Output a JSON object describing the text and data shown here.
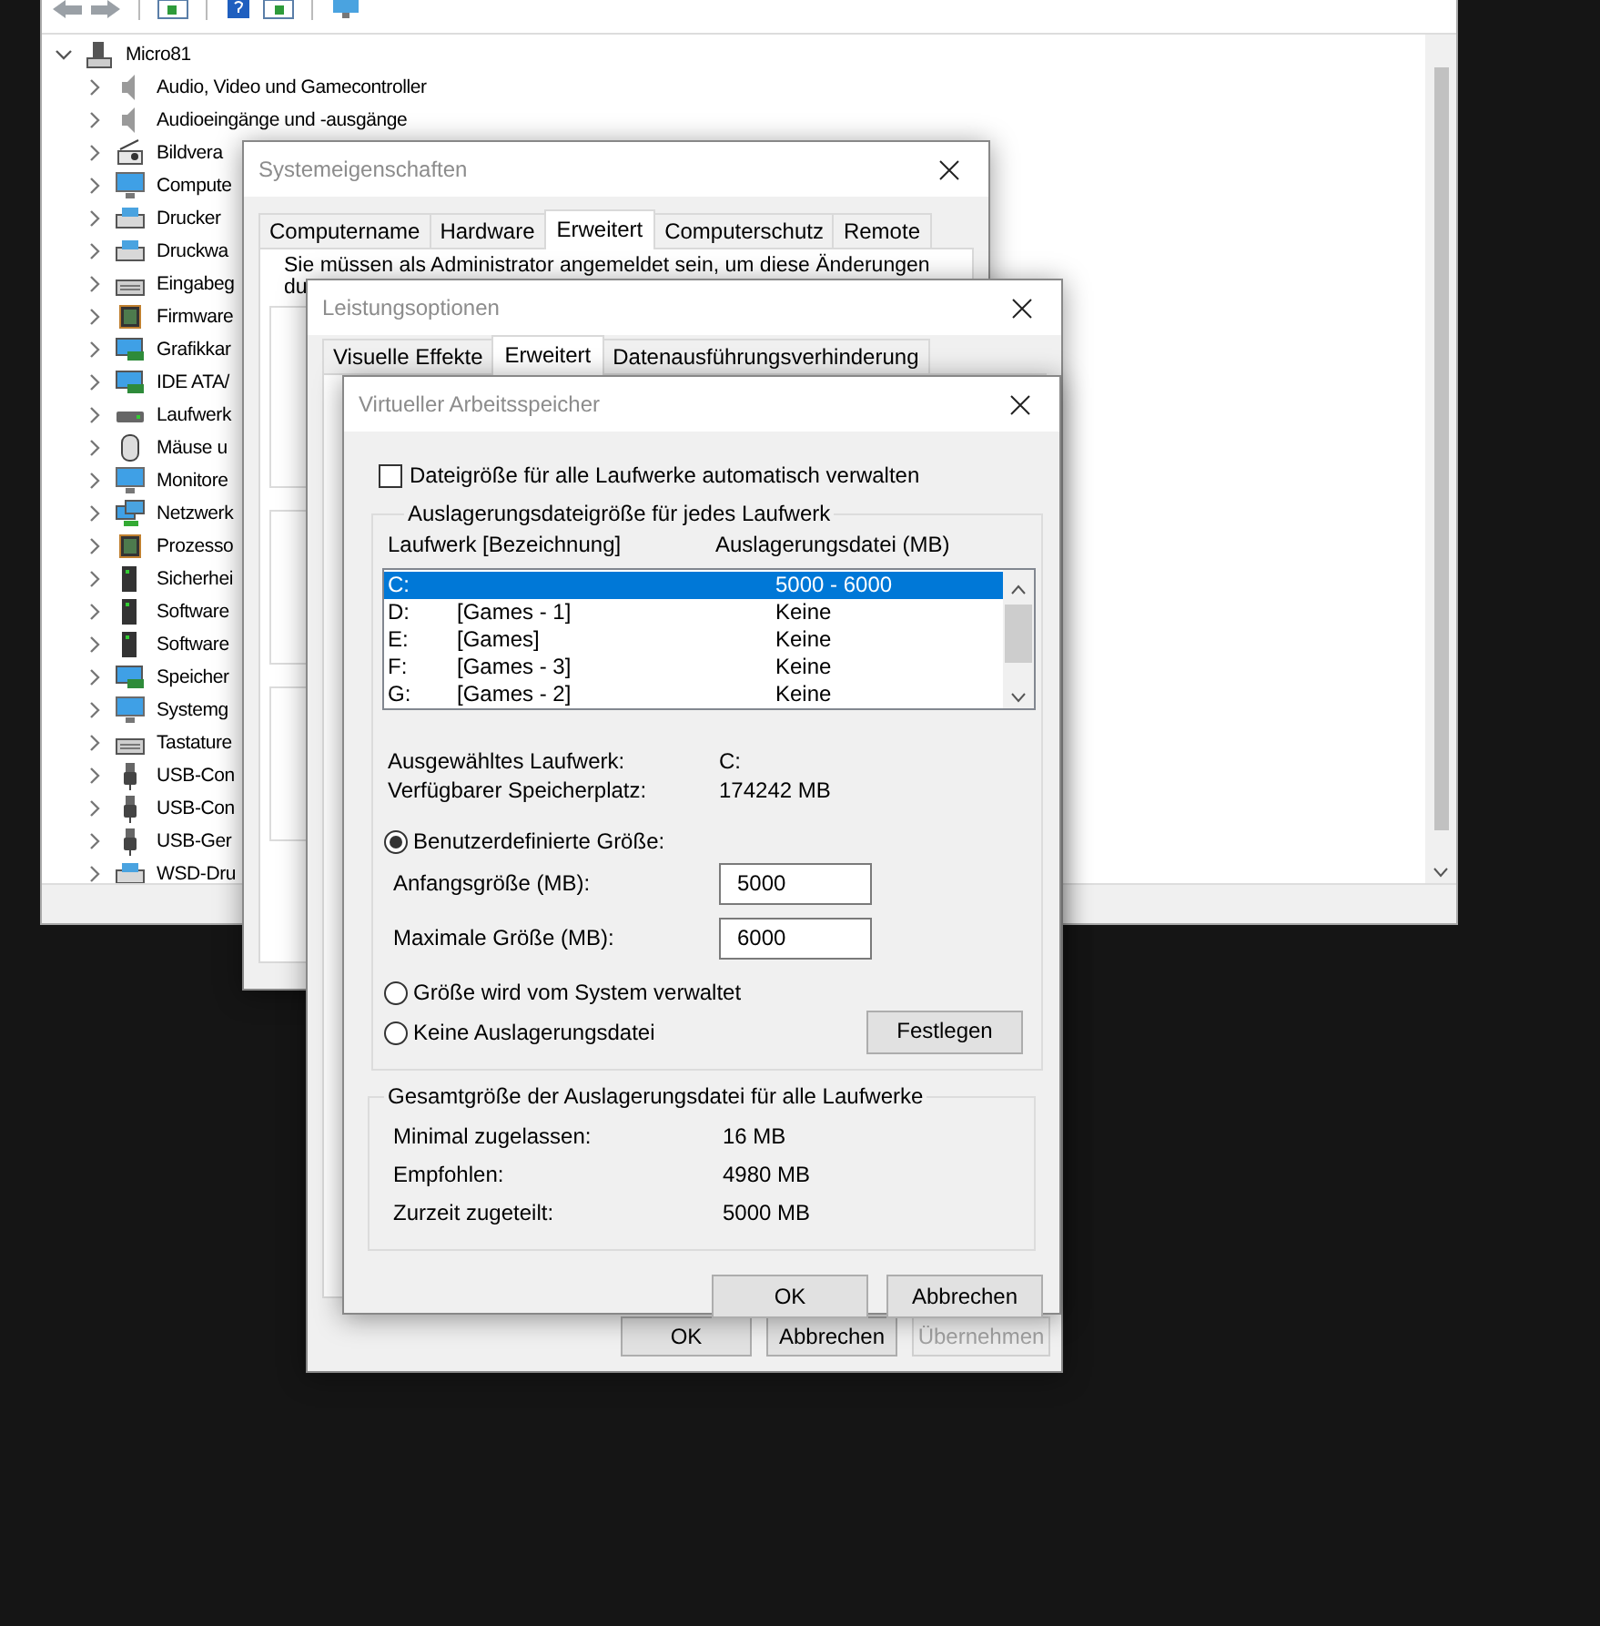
{
  "device_manager": {
    "tree": {
      "label": "Micro81",
      "expanded": true,
      "children": [
        {
          "label": "Audio, Video und Gamecontroller",
          "kind": "speaker",
          "expanded": false
        },
        {
          "label": "Audioeingänge und -ausgänge",
          "kind": "speaker",
          "expanded": false
        },
        {
          "label": "Bildvera",
          "kind": "camera",
          "expanded": false
        },
        {
          "label": "Compute",
          "kind": "monitor",
          "expanded": false
        },
        {
          "label": "Drucker",
          "kind": "printer",
          "expanded": false
        },
        {
          "label": "Druckwa",
          "kind": "printer",
          "expanded": false
        },
        {
          "label": "Eingabeg",
          "kind": "keyboard",
          "expanded": false
        },
        {
          "label": "Firmware",
          "kind": "chip",
          "expanded": false
        },
        {
          "label": "Grafikkar",
          "kind": "card",
          "expanded": false
        },
        {
          "label": "IDE ATA/",
          "kind": "card",
          "expanded": false
        },
        {
          "label": "Laufwerk",
          "kind": "drive",
          "expanded": false
        },
        {
          "label": "Mäuse u",
          "kind": "mouse",
          "expanded": false
        },
        {
          "label": "Monitore",
          "kind": "monitor",
          "expanded": false
        },
        {
          "label": "Netzwerk",
          "kind": "network",
          "expanded": false
        },
        {
          "label": "Prozesso",
          "kind": "chip",
          "expanded": false
        },
        {
          "label": "Sicherhei",
          "kind": "server",
          "expanded": false
        },
        {
          "label": "Software",
          "kind": "server",
          "expanded": false
        },
        {
          "label": "Software",
          "kind": "server",
          "expanded": false
        },
        {
          "label": "Speicher",
          "kind": "card",
          "expanded": false
        },
        {
          "label": "Systemg",
          "kind": "monitor",
          "expanded": false
        },
        {
          "label": "Tastature",
          "kind": "keyboard",
          "expanded": false
        },
        {
          "label": "USB-Con",
          "kind": "usb",
          "expanded": false
        },
        {
          "label": "USB-Con",
          "kind": "usb",
          "expanded": false
        },
        {
          "label": "USB-Ger",
          "kind": "usb",
          "expanded": false
        },
        {
          "label": "WSD-Dru",
          "kind": "printer",
          "expanded": false
        }
      ]
    }
  },
  "system_properties": {
    "title": "Systemeigenschaften",
    "tabs": [
      {
        "label": "Computername",
        "selected": false
      },
      {
        "label": "Hardware",
        "selected": false
      },
      {
        "label": "Erweitert",
        "selected": true
      },
      {
        "label": "Computerschutz",
        "selected": false
      },
      {
        "label": "Remote",
        "selected": false
      }
    ],
    "notice": "Sie müssen als Administrator angemeldet sein, um diese Änderungen",
    "notice_continued": "du"
  },
  "performance_options": {
    "title": "Leistungsoptionen",
    "tabs": [
      {
        "label": "Visuelle Effekte",
        "selected": false
      },
      {
        "label": "Erweitert",
        "selected": true
      },
      {
        "label": "Datenausführungsverhinderung",
        "selected": false
      }
    ],
    "buttons": [
      {
        "label": "OK",
        "disabled": false
      },
      {
        "label": "Abbrechen",
        "disabled": false
      },
      {
        "label": "Übernehmen",
        "disabled": true
      }
    ]
  },
  "virtual_memory": {
    "title": "Virtueller Arbeitsspeicher",
    "auto_manage": {
      "label": "Dateigröße für alle Laufwerke automatisch verwalten",
      "checked": false
    },
    "drive_group": {
      "title": "Auslagerungsdateigröße für jedes Laufwerk",
      "columns": [
        "Laufwerk [Bezeichnung]",
        "Auslagerungsdatei (MB)"
      ],
      "drives": [
        {
          "drive": "C:",
          "size": "5000 - 6000",
          "selected": true
        },
        {
          "drive": "D:",
          "label": "[Games - 1]",
          "size": "Keine",
          "selected": false
        },
        {
          "drive": "E:",
          "label": "[Games]",
          "size": "Keine",
          "selected": false
        },
        {
          "drive": "F:",
          "label": "[Games - 3]",
          "size": "Keine",
          "selected": false
        },
        {
          "drive": "G:",
          "label": "[Games - 2]",
          "size": "Keine",
          "selected": false
        }
      ],
      "info": [
        {
          "label": "Ausgewähltes Laufwerk:",
          "value": "C:"
        },
        {
          "label": "Verfügbarer Speicherplatz:",
          "value": "174242 MB"
        }
      ],
      "size_options": [
        {
          "label": "Benutzerdefinierte Größe:",
          "selected": true
        },
        {
          "label": "Größe wird vom System verwaltet",
          "selected": false
        },
        {
          "label": "Keine Auslagerungsdatei",
          "selected": false
        }
      ],
      "size_fields": [
        {
          "label": "Anfangsgröße (MB):",
          "value": "5000"
        },
        {
          "label": "Maximale Größe (MB):",
          "value": "6000"
        }
      ],
      "set_button": "Festlegen"
    },
    "totals": {
      "title": "Gesamtgröße der Auslagerungsdatei für alle Laufwerke",
      "rows": [
        {
          "label": "Minimal zugelassen:",
          "value": "16 MB"
        },
        {
          "label": "Empfohlen:",
          "value": "4980 MB"
        },
        {
          "label": "Zurzeit zugeteilt:",
          "value": "5000 MB"
        }
      ]
    },
    "buttons": [
      "OK",
      "Abbrechen"
    ]
  }
}
